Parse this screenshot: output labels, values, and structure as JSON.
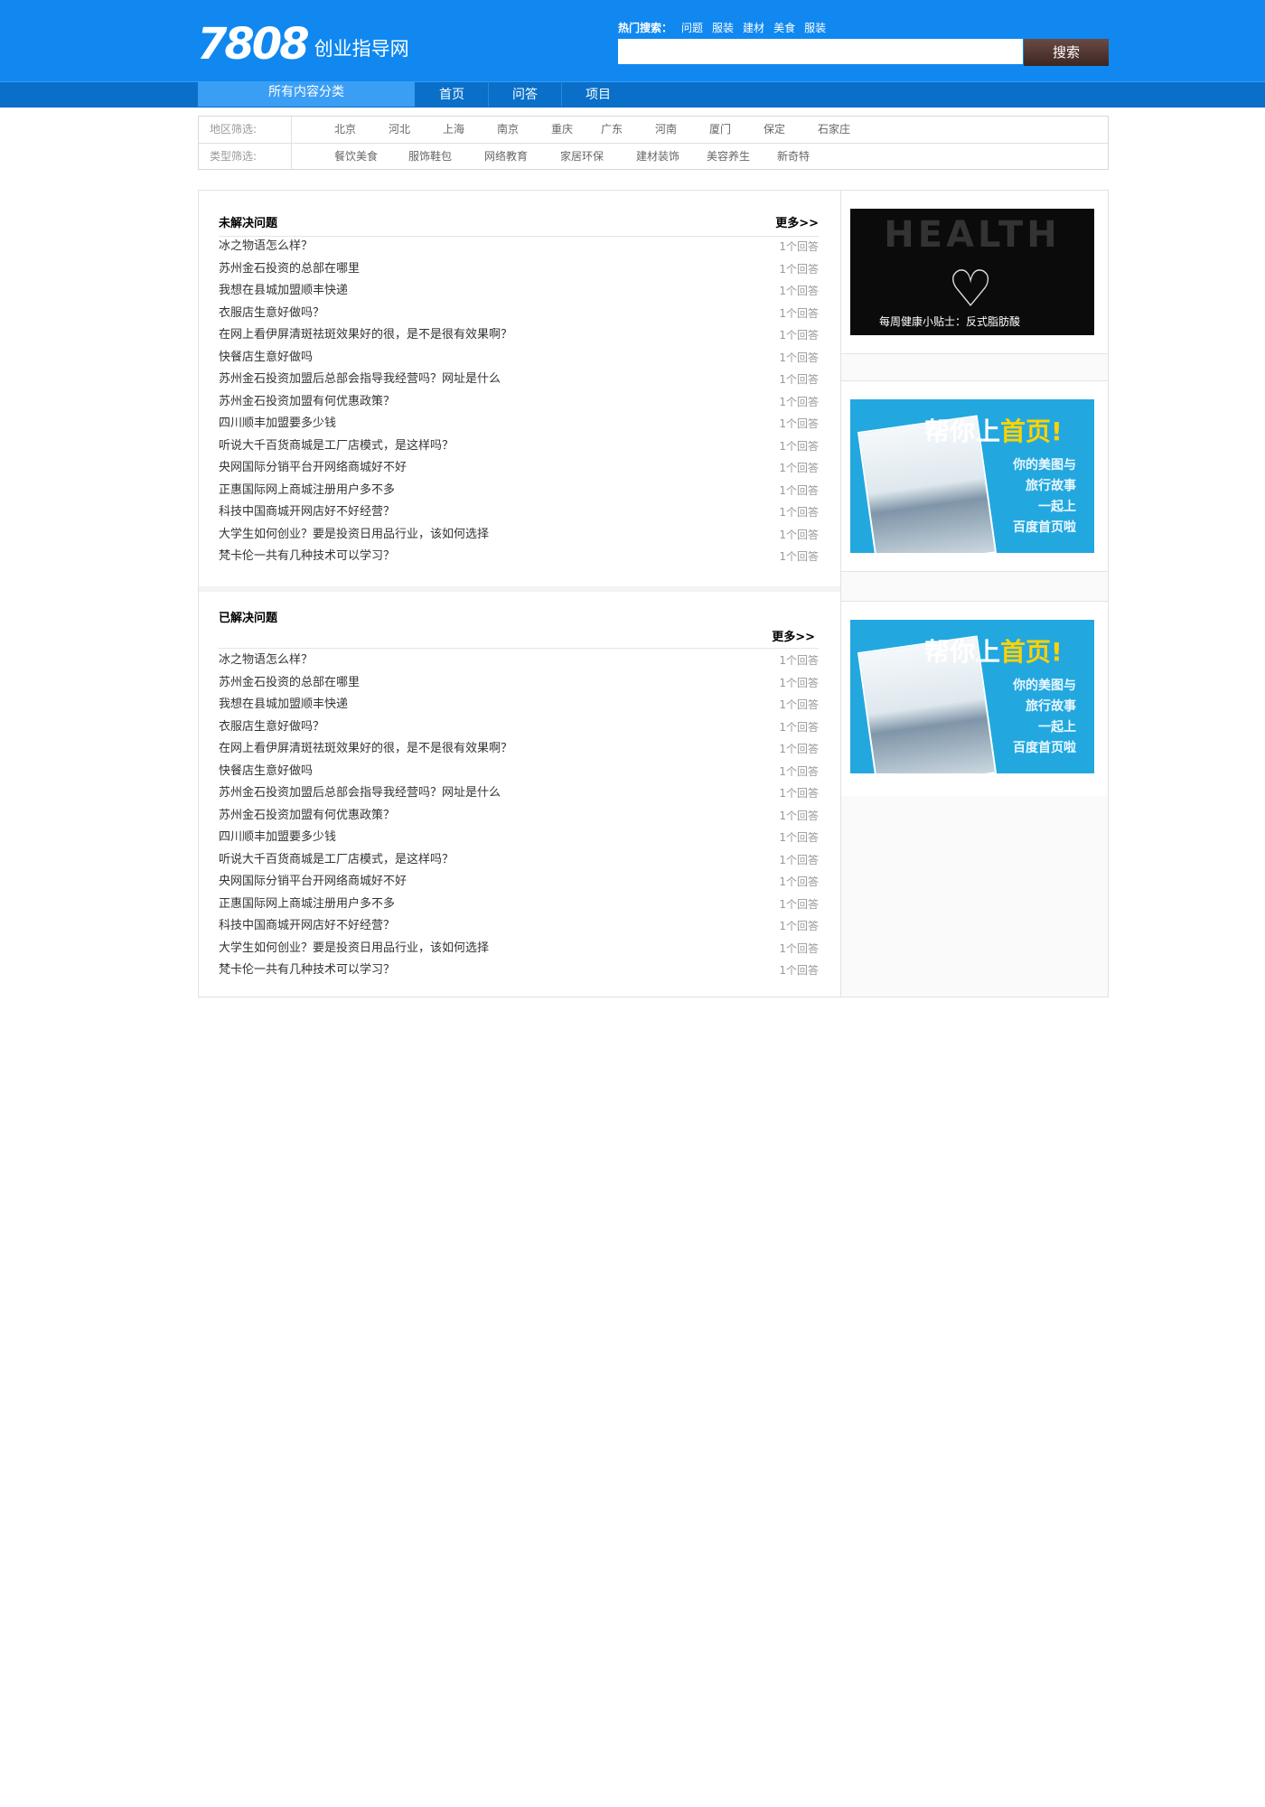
{
  "header": {
    "logo_number": "7808",
    "logo_text": "创业指导网",
    "hot_label": "热门搜索：",
    "hot_items": [
      "问题",
      "服装",
      "建材",
      "美食",
      "服装"
    ],
    "search_placeholder": "",
    "search_button": "搜索"
  },
  "nav": {
    "category_label": "所有内容分类",
    "items": [
      "首页",
      "问答",
      "项目"
    ]
  },
  "filters": {
    "region_label": "地区筛选:",
    "regions": [
      "北京",
      "河北",
      "上海",
      "南京",
      "重庆",
      "广东",
      "河南",
      "厦门",
      "保定",
      "石家庄"
    ],
    "type_label": "类型筛选:",
    "types": [
      "餐饮美食",
      "服饰鞋包",
      "网络教育",
      "家居环保",
      "建材装饰",
      "美容养生",
      "新奇特"
    ]
  },
  "unsolved": {
    "title": "未解决问题",
    "more": "更多>>",
    "items": [
      {
        "title": "冰之物语怎么样？",
        "count": "1个回答"
      },
      {
        "title": "苏州金石投资的总部在哪里",
        "count": "1个回答"
      },
      {
        "title": "我想在县城加盟顺丰快递",
        "count": "1个回答"
      },
      {
        "title": "衣服店生意好做吗？",
        "count": "1个回答"
      },
      {
        "title": "在网上看伊屏清斑祛斑效果好的很，是不是很有效果啊？",
        "count": "1个回答"
      },
      {
        "title": "快餐店生意好做吗",
        "count": "1个回答"
      },
      {
        "title": "苏州金石投资加盟后总部会指导我经营吗？网址是什么",
        "count": "1个回答"
      },
      {
        "title": "苏州金石投资加盟有何优惠政策？",
        "count": "1个回答"
      },
      {
        "title": "四川顺丰加盟要多少钱",
        "count": "1个回答"
      },
      {
        "title": "听说大千百货商城是工厂店模式，是这样吗？",
        "count": "1个回答"
      },
      {
        "title": "央网国际分销平台开网络商城好不好",
        "count": "1个回答"
      },
      {
        "title": "正惠国际网上商城注册用户多不多",
        "count": "1个回答"
      },
      {
        "title": "科技中国商城开网店好不好经营？",
        "count": "1个回答"
      },
      {
        "title": "大学生如何创业？要是投资日用品行业，该如何选择",
        "count": "1个回答"
      },
      {
        "title": "梵卡伦一共有几种技术可以学习？",
        "count": "1个回答"
      }
    ]
  },
  "solved": {
    "title": "已解决问题",
    "more": "更多>>",
    "items": [
      {
        "title": "冰之物语怎么样？",
        "count": "1个回答"
      },
      {
        "title": "苏州金石投资的总部在哪里",
        "count": "1个回答"
      },
      {
        "title": "我想在县城加盟顺丰快递",
        "count": "1个回答"
      },
      {
        "title": "衣服店生意好做吗？",
        "count": "1个回答"
      },
      {
        "title": "在网上看伊屏清斑祛斑效果好的很，是不是很有效果啊？",
        "count": "1个回答"
      },
      {
        "title": "快餐店生意好做吗",
        "count": "1个回答"
      },
      {
        "title": "苏州金石投资加盟后总部会指导我经营吗？网址是什么",
        "count": "1个回答"
      },
      {
        "title": "苏州金石投资加盟有何优惠政策？",
        "count": "1个回答"
      },
      {
        "title": "四川顺丰加盟要多少钱",
        "count": "1个回答"
      },
      {
        "title": "听说大千百货商城是工厂店模式，是这样吗？",
        "count": "1个回答"
      },
      {
        "title": "央网国际分销平台开网络商城好不好",
        "count": "1个回答"
      },
      {
        "title": "正惠国际网上商城注册用户多不多",
        "count": "1个回答"
      },
      {
        "title": "科技中国商城开网店好不好经营？",
        "count": "1个回答"
      },
      {
        "title": "大学生如何创业？要是投资日用品行业，该如何选择",
        "count": "1个回答"
      },
      {
        "title": "梵卡伦一共有几种技术可以学习？",
        "count": "1个回答"
      }
    ]
  },
  "sidebar": {
    "health_word": "HEALTH",
    "health_caption": "每周健康小贴士：反式脂肪酸",
    "ad_head_prefix": "帮你上",
    "ad_head_highlight": "首页!",
    "ad_lines": [
      "你的美图与",
      "旅行故事",
      "一起上",
      "百度首页啦"
    ]
  },
  "colors": {
    "header_blue": "#1088f0",
    "nav_band": "#0a6fc9",
    "nav_active": "#3b9ef5",
    "search_button": "#4a302b",
    "ad_blue": "#22a8df"
  }
}
